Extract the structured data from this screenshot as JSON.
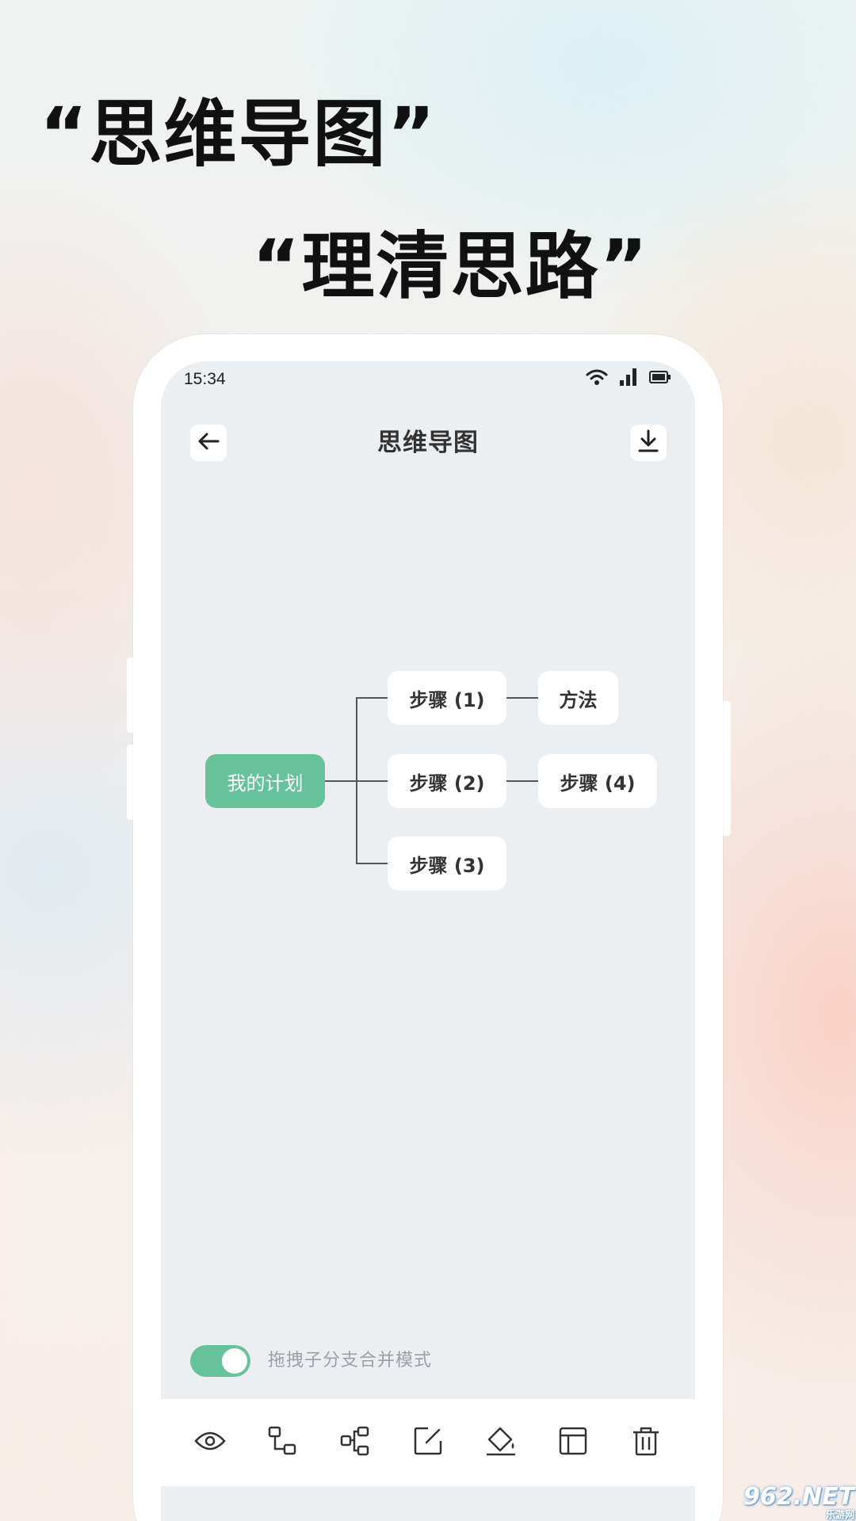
{
  "headline": {
    "line1": "“思维导图”",
    "line2": "“理清思路”"
  },
  "status_bar": {
    "time": "15:34",
    "icons": [
      "wifi-icon",
      "signal-icon",
      "battery-icon"
    ]
  },
  "header": {
    "title": "思维导图",
    "back_icon": "arrow-left-icon",
    "download_icon": "download-icon"
  },
  "mind_map": {
    "root": "我的计划",
    "children": [
      {
        "label": "步骤 (1)",
        "children": [
          "方法"
        ]
      },
      {
        "label": "步骤 (2)",
        "children": [
          "步骤 (4)"
        ]
      },
      {
        "label": "步骤 (3)",
        "children": []
      }
    ]
  },
  "toggle": {
    "label": "拖拽子分支合并模式",
    "on": true
  },
  "toolbar": {
    "items": [
      "eye-icon",
      "add-child-node-icon",
      "add-sibling-node-icon",
      "edit-icon",
      "paint-bucket-icon",
      "layout-icon",
      "trash-icon"
    ]
  },
  "watermark": {
    "text": "962.NET",
    "subtext": "乐游网"
  },
  "colors": {
    "accent": "#66c29a",
    "screen_bg": "#eceff2",
    "node_bg": "#ffffff"
  }
}
